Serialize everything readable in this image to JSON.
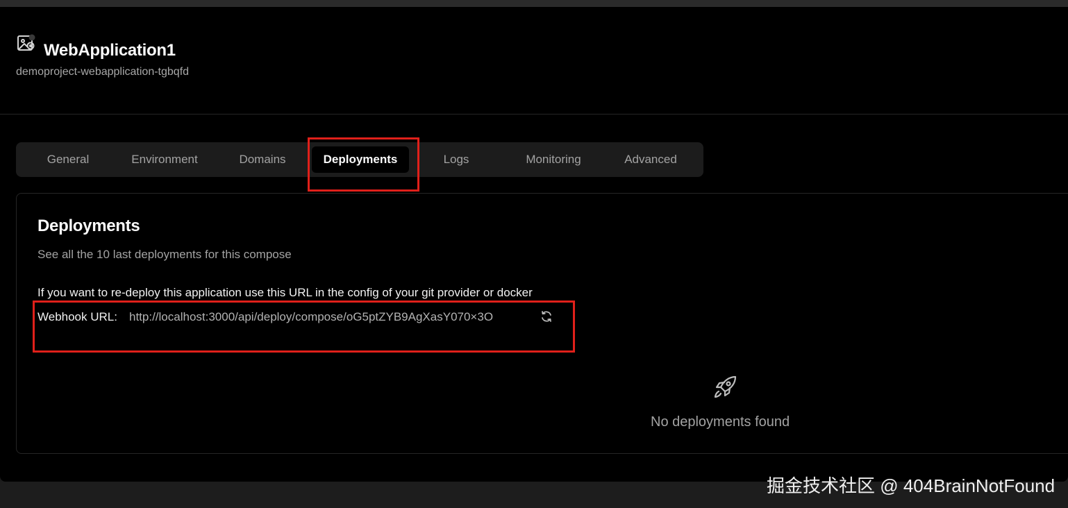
{
  "app": {
    "title": "WebApplication1",
    "slug": "demoproject-webapplication-tgbqfd",
    "icon": "application-icon"
  },
  "tabs": [
    {
      "label": "General",
      "active": false
    },
    {
      "label": "Environment",
      "active": false
    },
    {
      "label": "Domains",
      "active": false
    },
    {
      "label": "Deployments",
      "active": true
    },
    {
      "label": "Logs",
      "active": false
    },
    {
      "label": "Monitoring",
      "active": false
    },
    {
      "label": "Advanced",
      "active": false
    }
  ],
  "deployments": {
    "title": "Deployments",
    "description": "See all the 10 last deployments for this compose",
    "redeploy_note": "If you want to re-deploy this application use this URL in the config of your git provider or docker",
    "webhook_label": "Webhook URL:",
    "webhook_url": "http://localhost:3000/api/deploy/compose/oG5ptZYB9AgXasY070×3O",
    "refresh_icon": "refresh-icon",
    "empty_icon": "rocket-icon",
    "empty_text": "No deployments found"
  },
  "watermark": "掘金技术社区 @ 404BrainNotFound",
  "colors": {
    "background": "#000000",
    "tab_bar": "#1c1c1c",
    "highlight": "#e0201a",
    "muted_text": "#a3a3a3"
  }
}
